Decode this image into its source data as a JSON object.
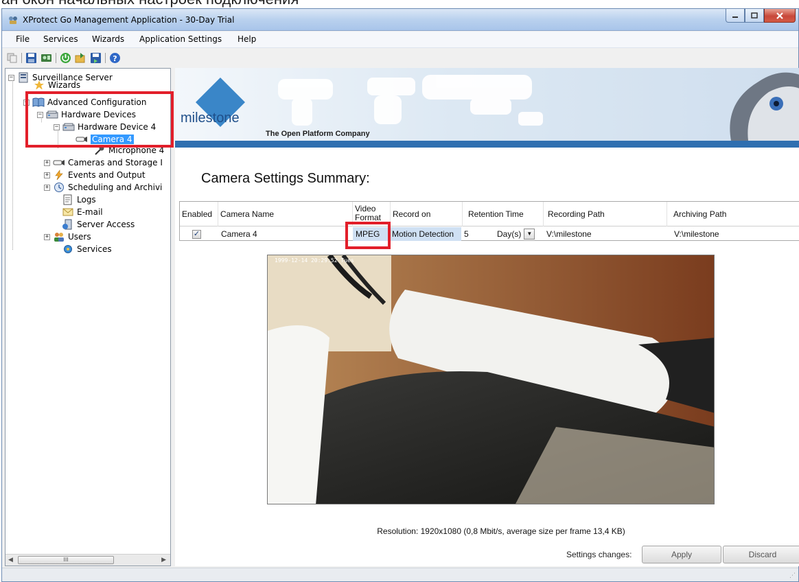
{
  "caption": {
    "text": "ан окон начальных настроек подключения"
  },
  "window": {
    "title": "XProtect Go Management Application - 30-Day Trial",
    "controls": [
      "minimize",
      "maximize",
      "close"
    ]
  },
  "menu": {
    "file": "File",
    "services": "Services",
    "wizards": "Wizards",
    "app_settings": "Application Settings",
    "help": "Help"
  },
  "toolbar_icons": [
    "copy-icon",
    "save-icon",
    "device-icon",
    "power-icon",
    "import-icon",
    "export-icon",
    "help-icon"
  ],
  "tree": {
    "root": "Surveillance Server",
    "wizards": "Wizards",
    "advanced": "Advanced Configuration",
    "hardware_devices": "Hardware Devices",
    "hardware_device_4": "Hardware Device 4",
    "camera_4": "Camera 4",
    "microphone_4": "Microphone 4",
    "cameras_storage": "Cameras and Storage I",
    "events_output": "Events and Output",
    "scheduling": "Scheduling and Archivi",
    "logs": "Logs",
    "email": "E-mail",
    "server_access": "Server Access",
    "users": "Users",
    "services": "Services"
  },
  "banner": {
    "logo": "milestone",
    "tagline": "The Open Platform Company"
  },
  "summary": {
    "title": "Camera Settings Summary:",
    "headers": {
      "enabled": "Enabled",
      "camera_name": "Camera Name",
      "video_format": "Video Format",
      "record_on": "Record on",
      "retention_time": "Retention Time",
      "recording_path": "Recording Path",
      "archiving_path": "Archiving Path"
    },
    "row": {
      "enabled_mark": "✓",
      "camera_name": "Camera 4",
      "video_format": "MPEG",
      "record_on": "Motion Detection",
      "retention_value": "5",
      "retention_unit": "Day(s)",
      "recording_path": "V:\\milestone",
      "archiving_path": "V:\\milestone"
    }
  },
  "preview": {
    "timestamp": "1999-12-14 20:29:52 Tues"
  },
  "footer": {
    "resolution": "Resolution: 1920x1080  (0,8 Mbit/s, average size per frame 13,4 KB)",
    "settings_changes": "Settings changes:",
    "apply": "Apply",
    "discard": "Discard"
  },
  "scrollbar": {
    "thumb_grip": "III"
  },
  "colors": {
    "highlight_red": "#e21f2a",
    "selection_blue": "#3399ff",
    "banner_bar": "#2f6fb0",
    "cell_highlight": "#cfe0f3"
  }
}
